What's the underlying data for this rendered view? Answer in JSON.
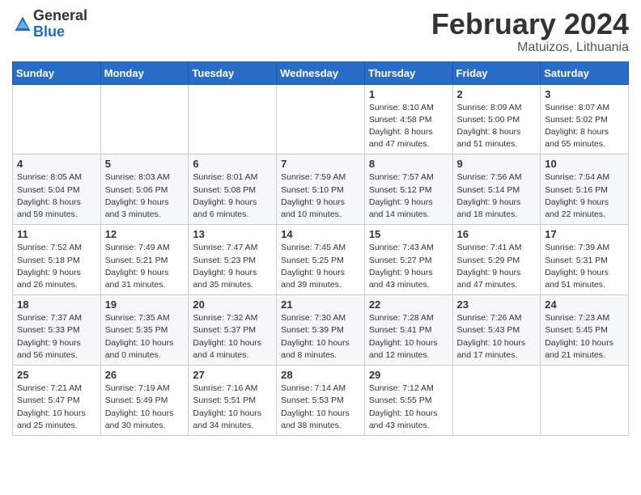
{
  "header": {
    "logo_general": "General",
    "logo_blue": "Blue",
    "month_year": "February 2024",
    "location": "Matuizos, Lithuania"
  },
  "weekdays": [
    "Sunday",
    "Monday",
    "Tuesday",
    "Wednesday",
    "Thursday",
    "Friday",
    "Saturday"
  ],
  "weeks": [
    [
      {
        "day": "",
        "info": ""
      },
      {
        "day": "",
        "info": ""
      },
      {
        "day": "",
        "info": ""
      },
      {
        "day": "",
        "info": ""
      },
      {
        "day": "1",
        "info": "Sunrise: 8:10 AM\nSunset: 4:58 PM\nDaylight: 8 hours\nand 47 minutes."
      },
      {
        "day": "2",
        "info": "Sunrise: 8:09 AM\nSunset: 5:00 PM\nDaylight: 8 hours\nand 51 minutes."
      },
      {
        "day": "3",
        "info": "Sunrise: 8:07 AM\nSunset: 5:02 PM\nDaylight: 8 hours\nand 55 minutes."
      }
    ],
    [
      {
        "day": "4",
        "info": "Sunrise: 8:05 AM\nSunset: 5:04 PM\nDaylight: 8 hours\nand 59 minutes."
      },
      {
        "day": "5",
        "info": "Sunrise: 8:03 AM\nSunset: 5:06 PM\nDaylight: 9 hours\nand 3 minutes."
      },
      {
        "day": "6",
        "info": "Sunrise: 8:01 AM\nSunset: 5:08 PM\nDaylight: 9 hours\nand 6 minutes."
      },
      {
        "day": "7",
        "info": "Sunrise: 7:59 AM\nSunset: 5:10 PM\nDaylight: 9 hours\nand 10 minutes."
      },
      {
        "day": "8",
        "info": "Sunrise: 7:57 AM\nSunset: 5:12 PM\nDaylight: 9 hours\nand 14 minutes."
      },
      {
        "day": "9",
        "info": "Sunrise: 7:56 AM\nSunset: 5:14 PM\nDaylight: 9 hours\nand 18 minutes."
      },
      {
        "day": "10",
        "info": "Sunrise: 7:54 AM\nSunset: 5:16 PM\nDaylight: 9 hours\nand 22 minutes."
      }
    ],
    [
      {
        "day": "11",
        "info": "Sunrise: 7:52 AM\nSunset: 5:18 PM\nDaylight: 9 hours\nand 26 minutes."
      },
      {
        "day": "12",
        "info": "Sunrise: 7:49 AM\nSunset: 5:21 PM\nDaylight: 9 hours\nand 31 minutes."
      },
      {
        "day": "13",
        "info": "Sunrise: 7:47 AM\nSunset: 5:23 PM\nDaylight: 9 hours\nand 35 minutes."
      },
      {
        "day": "14",
        "info": "Sunrise: 7:45 AM\nSunset: 5:25 PM\nDaylight: 9 hours\nand 39 minutes."
      },
      {
        "day": "15",
        "info": "Sunrise: 7:43 AM\nSunset: 5:27 PM\nDaylight: 9 hours\nand 43 minutes."
      },
      {
        "day": "16",
        "info": "Sunrise: 7:41 AM\nSunset: 5:29 PM\nDaylight: 9 hours\nand 47 minutes."
      },
      {
        "day": "17",
        "info": "Sunrise: 7:39 AM\nSunset: 5:31 PM\nDaylight: 9 hours\nand 51 minutes."
      }
    ],
    [
      {
        "day": "18",
        "info": "Sunrise: 7:37 AM\nSunset: 5:33 PM\nDaylight: 9 hours\nand 56 minutes."
      },
      {
        "day": "19",
        "info": "Sunrise: 7:35 AM\nSunset: 5:35 PM\nDaylight: 10 hours\nand 0 minutes."
      },
      {
        "day": "20",
        "info": "Sunrise: 7:32 AM\nSunset: 5:37 PM\nDaylight: 10 hours\nand 4 minutes."
      },
      {
        "day": "21",
        "info": "Sunrise: 7:30 AM\nSunset: 5:39 PM\nDaylight: 10 hours\nand 8 minutes."
      },
      {
        "day": "22",
        "info": "Sunrise: 7:28 AM\nSunset: 5:41 PM\nDaylight: 10 hours\nand 12 minutes."
      },
      {
        "day": "23",
        "info": "Sunrise: 7:26 AM\nSunset: 5:43 PM\nDaylight: 10 hours\nand 17 minutes."
      },
      {
        "day": "24",
        "info": "Sunrise: 7:23 AM\nSunset: 5:45 PM\nDaylight: 10 hours\nand 21 minutes."
      }
    ],
    [
      {
        "day": "25",
        "info": "Sunrise: 7:21 AM\nSunset: 5:47 PM\nDaylight: 10 hours\nand 25 minutes."
      },
      {
        "day": "26",
        "info": "Sunrise: 7:19 AM\nSunset: 5:49 PM\nDaylight: 10 hours\nand 30 minutes."
      },
      {
        "day": "27",
        "info": "Sunrise: 7:16 AM\nSunset: 5:51 PM\nDaylight: 10 hours\nand 34 minutes."
      },
      {
        "day": "28",
        "info": "Sunrise: 7:14 AM\nSunset: 5:53 PM\nDaylight: 10 hours\nand 38 minutes."
      },
      {
        "day": "29",
        "info": "Sunrise: 7:12 AM\nSunset: 5:55 PM\nDaylight: 10 hours\nand 43 minutes."
      },
      {
        "day": "",
        "info": ""
      },
      {
        "day": "",
        "info": ""
      }
    ]
  ]
}
